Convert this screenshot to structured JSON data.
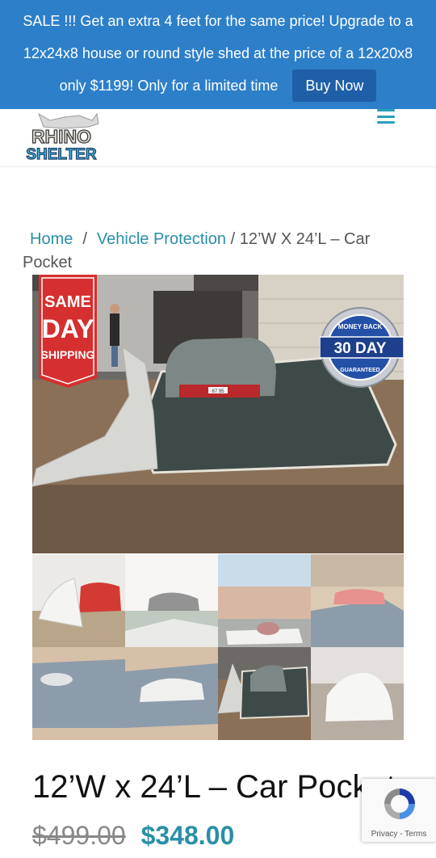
{
  "banner": {
    "line1": "SALE !!! Get an extra 4 feet for the same price! Upgrade to a",
    "line2": "12x24x8 house or round style shed at the price of a 12x20x8",
    "line3": "only $1199! Only for a limited time",
    "button_label": "Buy Now",
    "color": "#2d7fc9"
  },
  "header": {
    "logo_text_top": "RHINO",
    "logo_text_bottom": "SHELTER"
  },
  "breadcrumb": {
    "home": "Home",
    "separator": "/",
    "category": "Vehicle Protection",
    "current": "/ 12’W X 24’L – Car Pocket"
  },
  "main_image": {
    "badge_same_day": [
      "SAME",
      "DAY",
      "SHIPPING"
    ],
    "badge_money_back": {
      "top": "MONEY BACK",
      "middle": "30 DAY",
      "bottom": "GUARANTEED"
    },
    "plate": "67 95"
  },
  "product": {
    "title": "12’W x 24’L – Car Pocket",
    "old_price": "$499.00",
    "new_price": "$348.00",
    "accent_color": "#2a8fa8"
  },
  "recaptcha": {
    "links": "Privacy - Terms"
  }
}
